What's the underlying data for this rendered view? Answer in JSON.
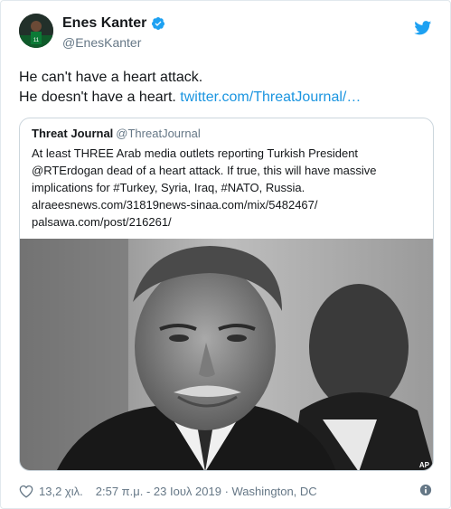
{
  "author": {
    "name": "Enes Kanter",
    "handle": "@EnesKanter"
  },
  "tweet": {
    "line1": "He can't have a heart attack.",
    "line2_text": "He doesn't have a heart. ",
    "line2_link": "twitter.com/ThreatJournal/…"
  },
  "quoted": {
    "name": "Threat Journal",
    "handle": "@ThreatJournal",
    "lines": [
      "At least THREE Arab media outlets reporting Turkish President",
      "@RTErdogan dead of a heart attack. If true, this will have massive",
      "implications for #Turkey, Syria, Iraq, #NATO, Russia.",
      "alraeesnews.com/31819news-sinaa.com/mix/5482467/",
      "palsawa.com/post/216261/"
    ],
    "photo_credit": "AP"
  },
  "meta": {
    "likes": "13,2 χιλ.",
    "timestamp": "2:57 π.μ. - 23 Ιουλ 2019 · Washington, DC"
  },
  "icons": {
    "verified": "verified-badge-icon",
    "bird": "twitter-bird-icon",
    "heart": "heart-icon",
    "info": "info-icon"
  },
  "colors": {
    "link": "#1b95e0",
    "twitter_blue": "#1da1f2",
    "secondary_text": "#657786"
  }
}
